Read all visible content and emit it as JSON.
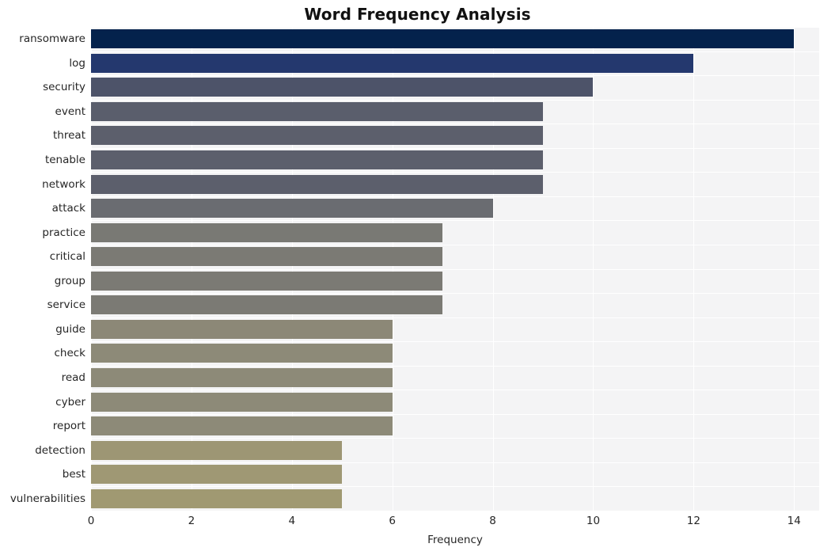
{
  "chart_data": {
    "type": "bar",
    "orientation": "horizontal",
    "title": "Word Frequency Analysis",
    "xlabel": "Frequency",
    "ylabel": "",
    "categories": [
      "ransomware",
      "log",
      "security",
      "event",
      "threat",
      "tenable",
      "network",
      "attack",
      "practice",
      "critical",
      "group",
      "service",
      "guide",
      "check",
      "read",
      "cyber",
      "report",
      "detection",
      "best",
      "vulnerabilities"
    ],
    "values": [
      14,
      12,
      10,
      9,
      9,
      9,
      9,
      8,
      7,
      7,
      7,
      7,
      6,
      6,
      6,
      6,
      6,
      5,
      5,
      5
    ],
    "bar_colors": [
      "#04224c",
      "#24386e",
      "#4d5369",
      "#5a5e6c",
      "#5c5f6c",
      "#5c5f6c",
      "#5c5f6c",
      "#6a6c71",
      "#797974",
      "#7b7a74",
      "#7b7a74",
      "#7b7a74",
      "#8c8877",
      "#8d8a78",
      "#8d8a78",
      "#8d8a78",
      "#8d8a78",
      "#9d9674",
      "#9f9874",
      "#a09972"
    ],
    "xticks": [
      0,
      2,
      4,
      6,
      8,
      10,
      12,
      14
    ],
    "xtick_labels": [
      "0",
      "2",
      "4",
      "6",
      "8",
      "10",
      "12",
      "14"
    ],
    "xlim": [
      0,
      14.5
    ],
    "grid": true,
    "grid_color": "#ffffff",
    "plot_background": "#f4f4f5",
    "figure_background": "#ffffff",
    "legend": "none",
    "style": "whitegrid"
  }
}
